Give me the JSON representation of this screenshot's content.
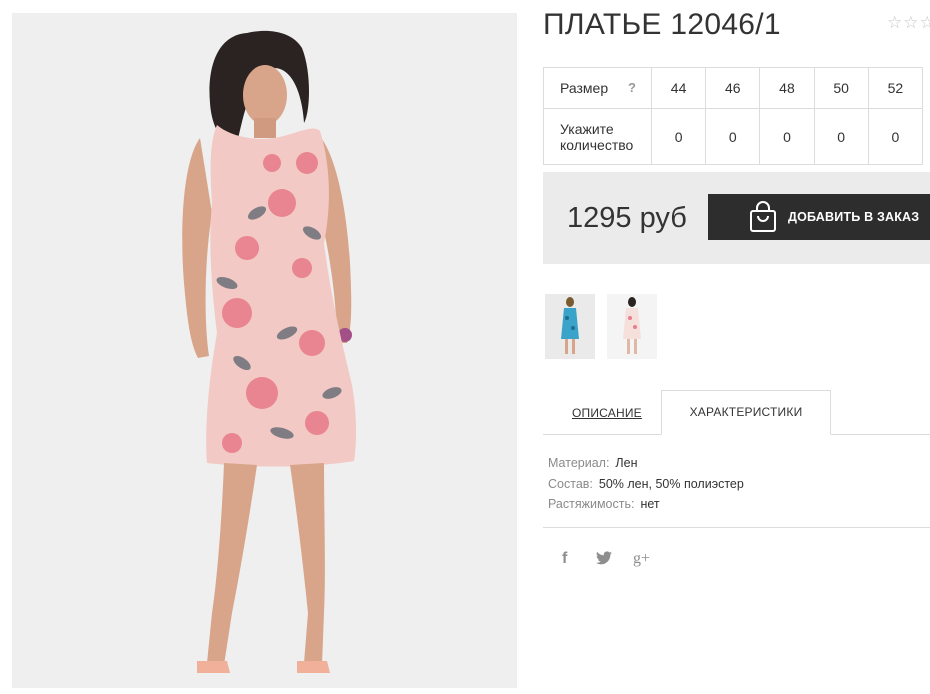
{
  "product": {
    "title": "ПЛАТЬЕ 12046/1",
    "rating_stars": [
      "☆",
      "☆",
      "☆"
    ],
    "price": "1295 руб",
    "add_button_label": "ДОБАВИТЬ В ЗАКАЗ"
  },
  "sizes": {
    "size_label": "Размер",
    "size_hint": "?",
    "quantity_label": "Укажите количество",
    "sizes": [
      "44",
      "46",
      "48",
      "50",
      "52"
    ],
    "quantities": [
      "0",
      "0",
      "0",
      "0",
      "0"
    ]
  },
  "tabs": {
    "description": "ОПИСАНИЕ",
    "characteristics": "ХАРАКТЕРИСТИКИ"
  },
  "specs": [
    {
      "key": "Материал:",
      "value": "Лен"
    },
    {
      "key": "Состав:",
      "value": "50% лен, 50% полиэстер"
    },
    {
      "key": "Растяжимость:",
      "value": "нет"
    }
  ],
  "social": {
    "facebook": "f",
    "twitter": "🐦",
    "googleplus": "g+"
  },
  "colors": {
    "button_bg": "#2d2d2d",
    "price_bg": "#ebebeb",
    "dress_pink": "#f2c9c4",
    "flower_pink": "#e87e8c",
    "leaf_gray": "#6b6f78"
  },
  "icons": {
    "bag": "shopping-bag-icon",
    "star": "star-outline-icon"
  }
}
